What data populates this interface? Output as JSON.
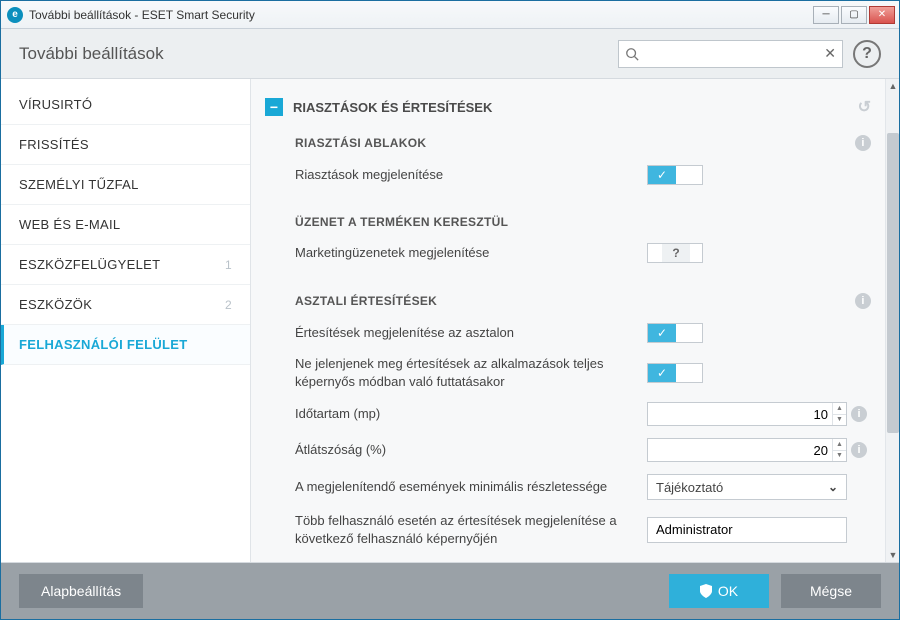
{
  "window": {
    "title": "További beállítások - ESET Smart Security",
    "logo_letter": "e"
  },
  "header": {
    "title": "További beállítások",
    "search_placeholder": ""
  },
  "sidebar": {
    "items": [
      {
        "label": "VÍRUSIRTÓ",
        "count": ""
      },
      {
        "label": "FRISSÍTÉS",
        "count": ""
      },
      {
        "label": "SZEMÉLYI TŰZFAL",
        "count": ""
      },
      {
        "label": "WEB ÉS E-MAIL",
        "count": ""
      },
      {
        "label": "ESZKÖZFELÜGYELET",
        "count": "1"
      },
      {
        "label": "ESZKÖZÖK",
        "count": "2"
      },
      {
        "label": "FELHASZNÁLÓI FELÜLET",
        "count": ""
      }
    ]
  },
  "section": {
    "title": "RIASZTÁSOK ÉS ÉRTESÍTÉSEK",
    "sub1": {
      "title": "RIASZTÁSI ABLAKOK",
      "row1": "Riasztások megjelenítése"
    },
    "sub2": {
      "title": "ÜZENET A TERMÉKEN KERESZTÜL",
      "row1": "Marketingüzenetek megjelenítése"
    },
    "sub3": {
      "title": "ASZTALI ÉRTESÍTÉSEK",
      "row1": "Értesítések megjelenítése az asztalon",
      "row2": "Ne jelenjenek meg értesítések az alkalmazások teljes képernyős módban való futtatásakor",
      "row3": "Időtartam (mp)",
      "row3_value": "10",
      "row4": "Átlátszóság (%)",
      "row4_value": "20",
      "row5": "A megjelenítendő események minimális részletessége",
      "row5_value": "Tájékoztató",
      "row6": "Több felhasználó esetén az értesítések megjelenítése a következő felhasználó képernyőjén",
      "row6_value": "Administrator"
    }
  },
  "footer": {
    "default": "Alapbeállítás",
    "ok": "OK",
    "cancel": "Mégse"
  }
}
